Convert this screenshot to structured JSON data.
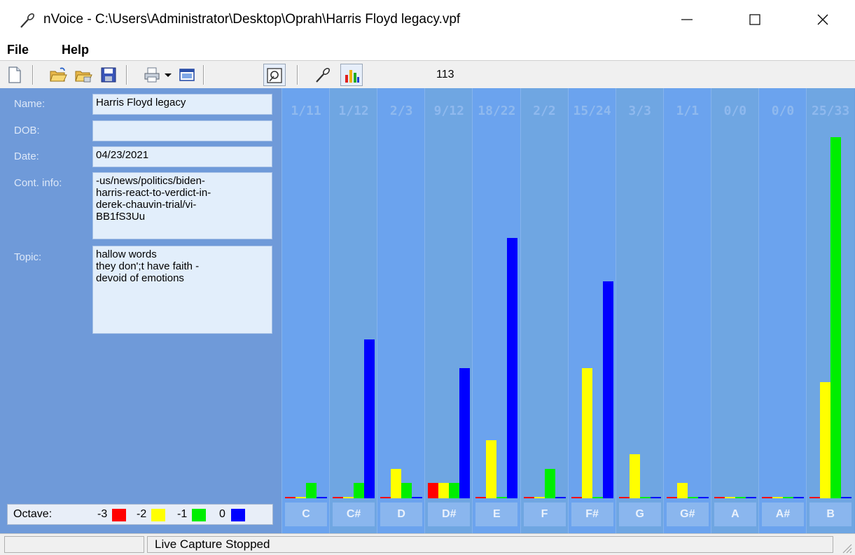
{
  "window": {
    "title": "nVoice - C:\\Users\\Administrator\\Desktop\\Oprah\\Harris Floyd legacy.vpf",
    "minimize_glyph": "—",
    "maximize_glyph": "☐",
    "close_glyph": "✕"
  },
  "menu": {
    "file": "File",
    "help": "Help"
  },
  "toolbar": {
    "icons": [
      "new-file-icon",
      "open-folder-icon",
      "open-folder-alt-icon",
      "save-icon",
      "print-icon",
      "dropdown-arrow-icon",
      "window-icon",
      "record-settings-icon",
      "microphone-icon",
      "bar-chart-icon"
    ],
    "counter": "113"
  },
  "form": {
    "name_label": "Name:",
    "name_value": "Harris Floyd legacy",
    "dob_label": "DOB:",
    "dob_value": "",
    "date_label": "Date:",
    "date_value": "04/23/2021",
    "contact_label": "Cont. info:",
    "contact_value": "-us/news/politics/biden-\nharris-react-to-verdict-in-\nderek-chauvin-trial/vi-\nBB1fS3Uu",
    "topic_label": "Topic:",
    "topic_value": "hallow words\nthey don';t have faith -\ndevoid of emotions"
  },
  "legend": {
    "octave_label": "Octave:",
    "items": [
      {
        "label": "-3",
        "color": "#ff0000"
      },
      {
        "label": "-2",
        "color": "#ffff00"
      },
      {
        "label": "-1",
        "color": "#00ee00"
      },
      {
        "label": "0",
        "color": "#0000ff"
      }
    ]
  },
  "chart_data": {
    "type": "bar",
    "categories": [
      "C",
      "C#",
      "D",
      "D#",
      "E",
      "F",
      "F#",
      "G",
      "G#",
      "A",
      "A#",
      "B"
    ],
    "column_headers": [
      "1/11",
      "1/12",
      "2/3",
      "9/12",
      "18/22",
      "2/2",
      "15/24",
      "3/3",
      "1/1",
      "0/0",
      "0/0",
      "25/33"
    ],
    "series": [
      {
        "name": "-3",
        "color": "#ff0000",
        "values": [
          0,
          0,
          0,
          1,
          0,
          0,
          0,
          0,
          0,
          0,
          0,
          0
        ]
      },
      {
        "name": "-2",
        "color": "#ffff00",
        "values": [
          0,
          0,
          2,
          1,
          4,
          0,
          9,
          3,
          1,
          0,
          0,
          8
        ]
      },
      {
        "name": "-1",
        "color": "#00ee00",
        "values": [
          1,
          1,
          1,
          1,
          0,
          2,
          0,
          0,
          0,
          0,
          0,
          25
        ]
      },
      {
        "name": "0",
        "color": "#0000ff",
        "values": [
          0,
          11,
          0,
          9,
          18,
          0,
          15,
          0,
          0,
          0,
          0,
          0
        ]
      }
    ],
    "ylim": [
      0,
      25.5
    ],
    "grid": false,
    "legend_position": "bottom-left"
  },
  "status": {
    "left": "",
    "right": "Live Capture Stopped"
  }
}
